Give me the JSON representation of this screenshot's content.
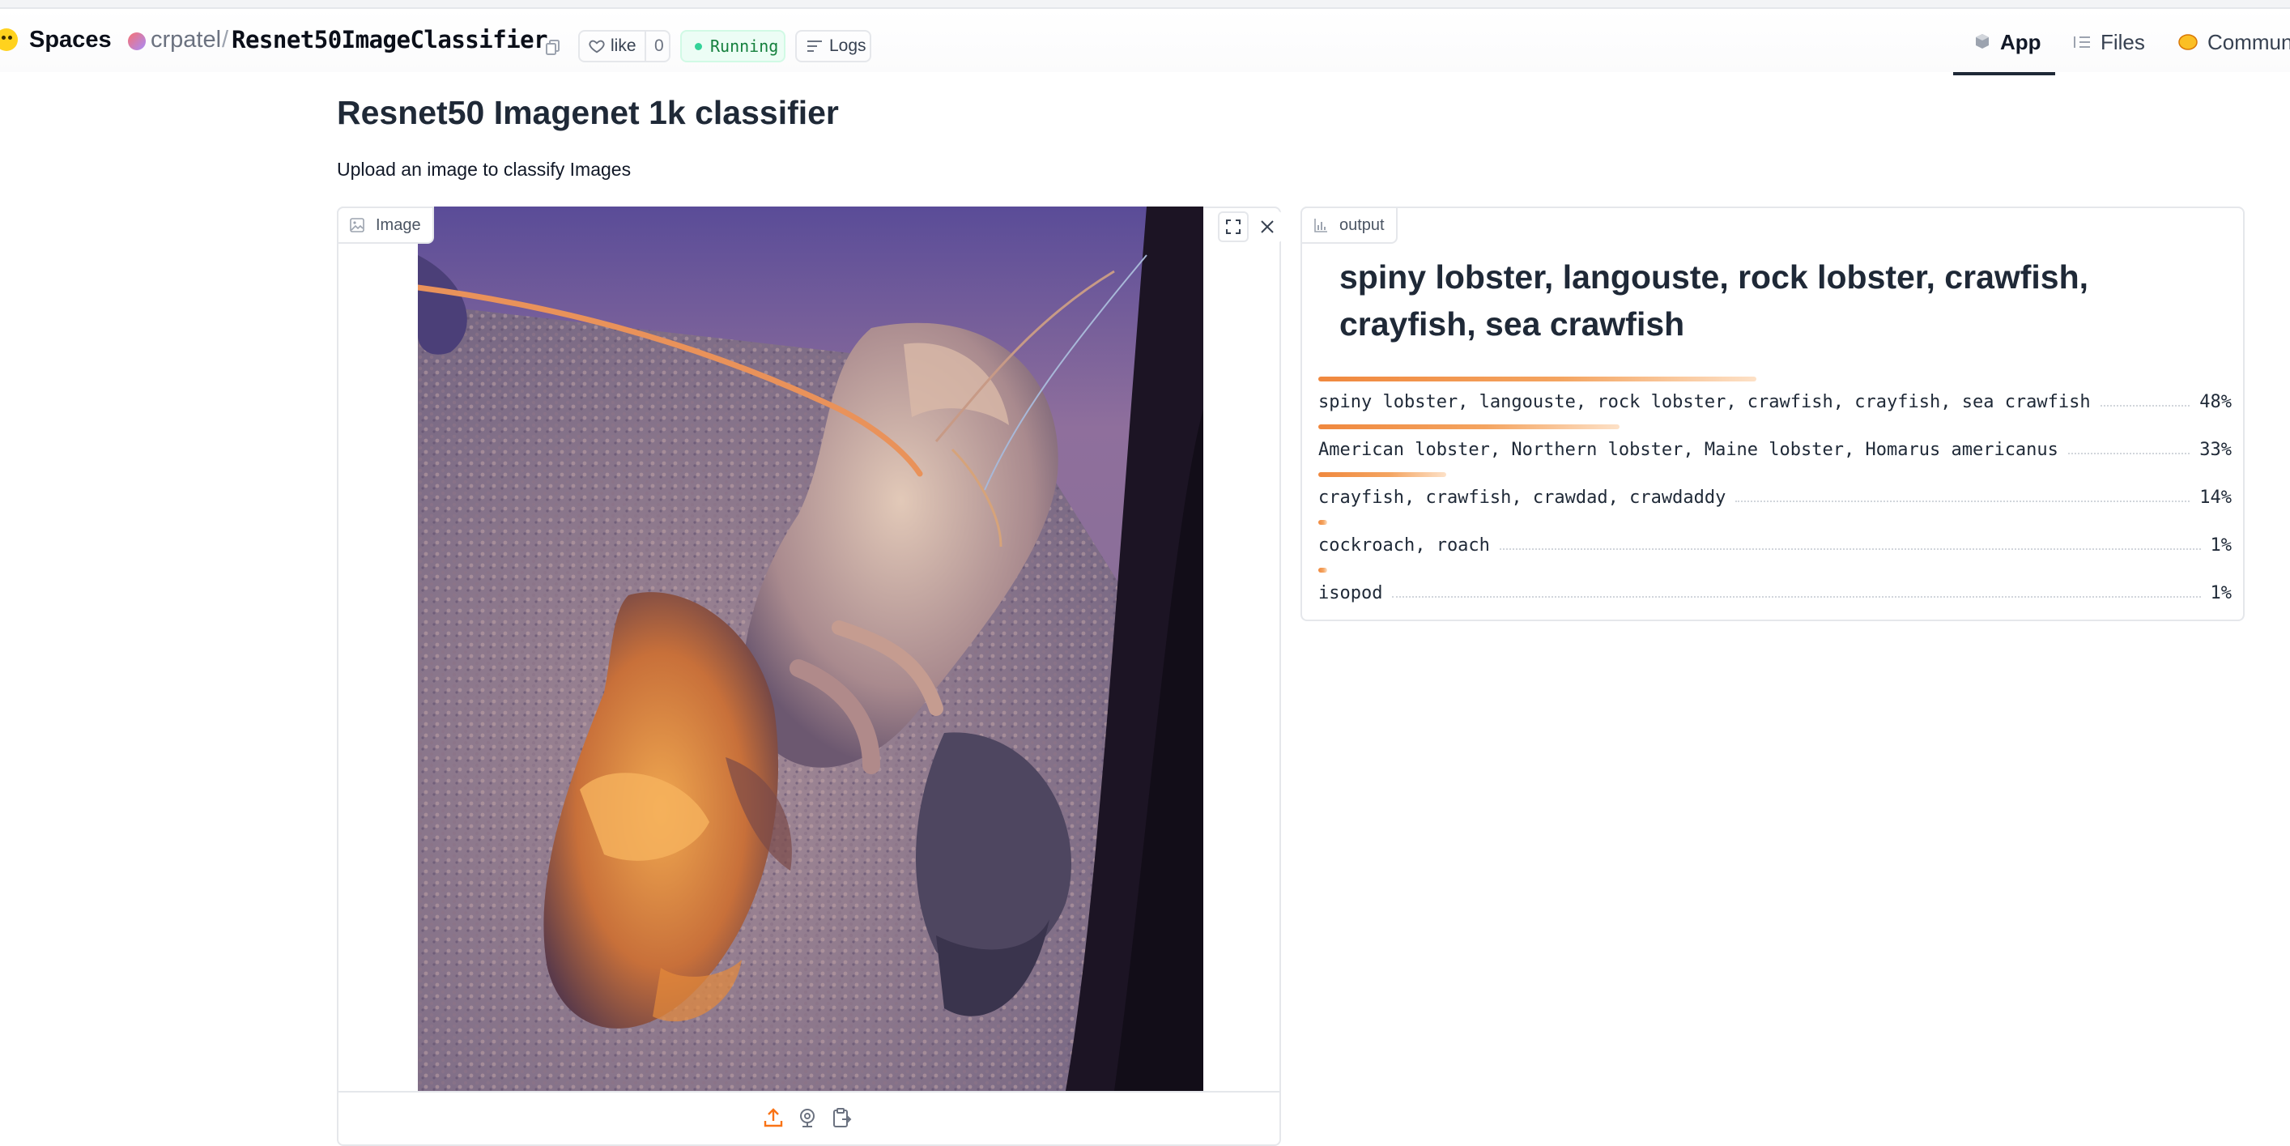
{
  "header": {
    "spaces_label": "Spaces",
    "owner": "crpatel",
    "separator": "/",
    "repo": "Resnet50ImageClassifier",
    "like_label": "like",
    "like_count": "0",
    "status": "Running",
    "logs_label": "Logs",
    "nav": {
      "app": "App",
      "files": "Files",
      "community": "Communi"
    }
  },
  "page": {
    "title": "Resnet50 Imagenet 1k classifier",
    "description": "Upload an image to classify Images"
  },
  "input_panel": {
    "label": "Image"
  },
  "output_panel": {
    "label": "output",
    "top_label": "spiny lobster, langouste, rock lobster, crawfish, crayfish, sea crawfish",
    "confidences": [
      {
        "label": "spiny lobster, langouste, rock lobster, crawfish, crayfish, sea crawfish",
        "percent": "48%",
        "value": 0.48
      },
      {
        "label": "American lobster, Northern lobster, Maine lobster, Homarus americanus",
        "percent": "33%",
        "value": 0.33
      },
      {
        "label": "crayfish, crawfish, crawdad, crawdaddy",
        "percent": "14%",
        "value": 0.14
      },
      {
        "label": "cockroach, roach",
        "percent": "1%",
        "value": 0.01
      },
      {
        "label": "isopod",
        "percent": "1%",
        "value": 0.01
      }
    ]
  },
  "colors": {
    "accent": "#f0883e",
    "running": "#15803d"
  }
}
